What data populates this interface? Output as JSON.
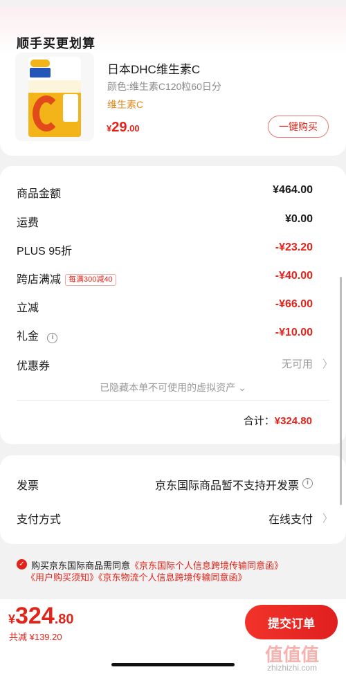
{
  "deal": {
    "title": "顺手买更划算",
    "product": {
      "name": "日本DHC维生素C",
      "spec": "颜色:维生素C120粒60日分",
      "tag": "维生素C",
      "price_symbol": "¥",
      "price_int": "29",
      "price_dec": ".00",
      "image_icon": "dhc-vitamin-c-package-icon"
    },
    "buy_button": "一键购买"
  },
  "summary": {
    "rows": [
      {
        "label": "商品金额",
        "value": "¥464.00"
      },
      {
        "label": "运费",
        "value": "¥0.00"
      },
      {
        "label": "PLUS 95折",
        "value": "-¥23.20"
      },
      {
        "label": "跨店满减",
        "badge": "每满300减40",
        "value": "-¥40.00"
      },
      {
        "label": "立减",
        "value": "-¥66.00"
      },
      {
        "label": "礼金",
        "value": "-¥10.00"
      },
      {
        "label": "优惠券",
        "value": "无可用"
      }
    ],
    "hidden_note": "已隐藏本单不可使用的虚拟资产",
    "total_label": "合计：",
    "total_value": "¥324.80"
  },
  "invoice": {
    "invoice_label": "发票",
    "invoice_value": "京东国际商品暂不支持开发票",
    "payment_label": "支付方式",
    "payment_value": "在线支付"
  },
  "consent": {
    "prefix": "购买京东国际商品需同意",
    "link1": "《京东国际个人信息跨境传输同意函》",
    "link2": "《用户购买须知》",
    "link3": "《京东物流个人信息跨境传输同意函》"
  },
  "footer": {
    "price_symbol": "¥",
    "price_int": "324",
    "price_dec": ".80",
    "savings": "共减 ¥139.20",
    "submit": "提交订单"
  },
  "watermark": {
    "mark": "值值值",
    "site": "zhizhizhi.com"
  },
  "colors": {
    "accent": "#e2231a",
    "tag_orange": "#e08a1e",
    "muted": "#9a9a9a"
  }
}
